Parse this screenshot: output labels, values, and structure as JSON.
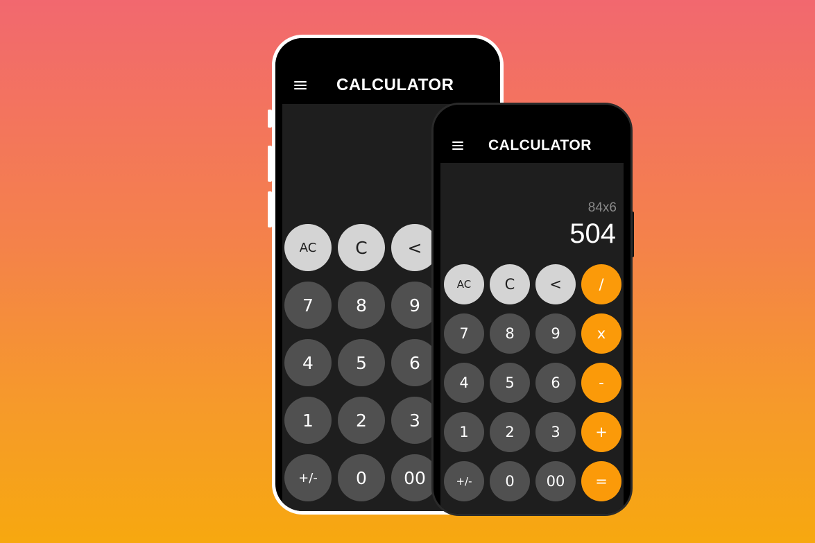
{
  "back_phone": {
    "title": "CALCULATOR",
    "rows": [
      [
        "AC",
        "C",
        "<"
      ],
      [
        "7",
        "8",
        "9"
      ],
      [
        "4",
        "5",
        "6"
      ],
      [
        "1",
        "2",
        "3"
      ],
      [
        "+/-",
        "0",
        "00"
      ]
    ]
  },
  "front_phone": {
    "title": "CALCULATOR",
    "expression": "84x6",
    "result": "504",
    "rows": [
      [
        "AC",
        "C",
        "<",
        "/"
      ],
      [
        "7",
        "8",
        "9",
        "x"
      ],
      [
        "4",
        "5",
        "6",
        "-"
      ],
      [
        "1",
        "2",
        "3",
        "+"
      ],
      [
        "+/-",
        "0",
        "00",
        "="
      ]
    ]
  },
  "colors": {
    "function_key": "#d4d4d4",
    "number_key": "#505050",
    "operator_key": "#fb9a09",
    "screen": "#1e1e1e"
  },
  "icons": {
    "menu": "hamburger-menu-icon"
  }
}
